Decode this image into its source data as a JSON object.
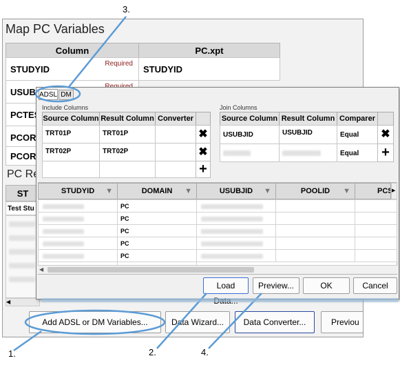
{
  "main": {
    "title": "Map PC Variables",
    "columns": [
      "Column",
      "PC.xpt"
    ],
    "rows": [
      {
        "column": "STUDYID",
        "required": "Required",
        "value": "STUDYID"
      },
      {
        "column": "USUBJ",
        "required": "Required",
        "value": ""
      },
      {
        "column": "PCTES",
        "required": "",
        "value": ""
      },
      {
        "column": "PCORE",
        "required": "",
        "value": ""
      },
      {
        "column": "PCORE",
        "required": "",
        "value": ""
      }
    ],
    "section_label": "PC Re",
    "bottom_header": "ST",
    "bottom_first_cell": "Test Stu"
  },
  "footer_buttons": {
    "add": "Add ADSL or DM Variables...",
    "wizard": "Data Wizard...",
    "converter": "Data Converter...",
    "previous": "Previou"
  },
  "dialog": {
    "tabs": [
      "ADSL",
      "DM"
    ],
    "include": {
      "label": "Include Columns",
      "headers": [
        "Source Column",
        "Result Column",
        "Converter"
      ],
      "rows": [
        {
          "source": "TRT01P",
          "result": "TRT01P",
          "converter": ""
        },
        {
          "source": "TRT02P",
          "result": "TRT02P",
          "converter": ""
        }
      ]
    },
    "join": {
      "label": "Join Columns",
      "headers": [
        "Source Column",
        "Result Column",
        "Comparer"
      ],
      "rows": [
        {
          "source": "USUBJID",
          "result": "USUBJID",
          "comparer": "Equal"
        },
        {
          "source": "",
          "result": "",
          "comparer": "Equal"
        }
      ]
    },
    "grid": {
      "headers": [
        "STUDYID",
        "DOMAIN",
        "USUBJID",
        "POOLID",
        "PCS"
      ],
      "domain_values": [
        "PC",
        "PC",
        "PC",
        "PC",
        "PC",
        "PC"
      ]
    },
    "buttons": {
      "load": "Load Data...",
      "preview": "Preview...",
      "ok": "OK",
      "cancel": "Cancel"
    }
  },
  "callouts": {
    "one": "1.",
    "two": "2.",
    "three": "3.",
    "four": "4."
  },
  "colors": {
    "callout": "#5b9bd5",
    "required": "#8b1a1a"
  }
}
